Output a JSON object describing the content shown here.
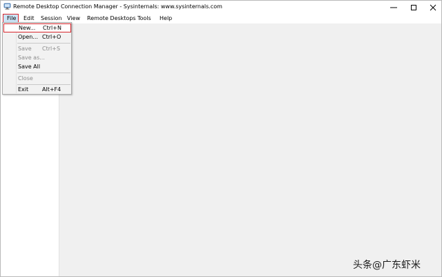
{
  "window": {
    "title": "Remote Desktop Connection Manager - Sysinternals: www.sysinternals.com"
  },
  "menubar": {
    "items": [
      "File",
      "Edit",
      "Session",
      "View",
      "Remote Desktops",
      "Tools",
      "Help"
    ]
  },
  "file_menu": {
    "items": [
      {
        "label": "New...",
        "shortcut": "Ctrl+N",
        "enabled": true,
        "highlighted": true
      },
      {
        "label": "Open...",
        "shortcut": "Ctrl+O",
        "enabled": true
      },
      {
        "label": "Save",
        "shortcut": "Ctrl+S",
        "enabled": false
      },
      {
        "label": "Save as...",
        "shortcut": "",
        "enabled": false
      },
      {
        "label": "Save All",
        "shortcut": "",
        "enabled": true
      },
      {
        "label": "Close",
        "shortcut": "",
        "enabled": false
      },
      {
        "label": "Exit",
        "shortcut": "Alt+F4",
        "enabled": true
      }
    ]
  },
  "watermark": {
    "text": "头条@广东虾米"
  },
  "colors": {
    "highlight_border": "#d8232a",
    "menu_hover": "#cce4f7",
    "workspace": "#f0f0f0"
  },
  "icons": {
    "app": "rdcman-computer-icon",
    "minimize": "minimize-icon",
    "maximize": "maximize-icon",
    "close": "close-icon"
  }
}
